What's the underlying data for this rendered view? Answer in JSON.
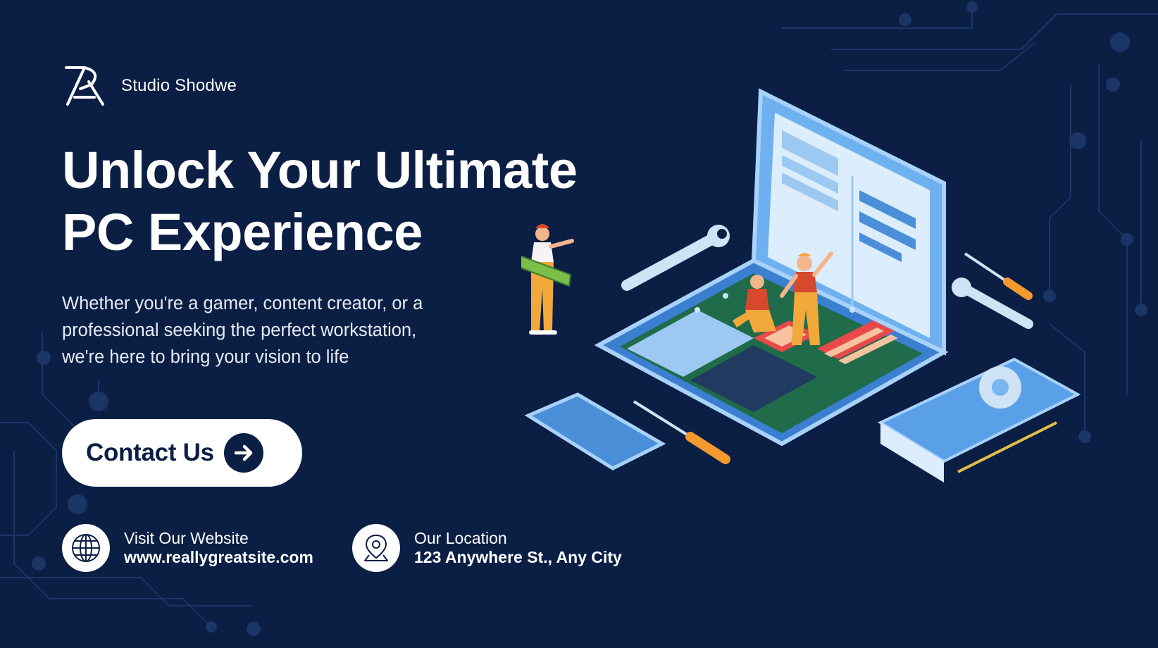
{
  "brand": {
    "name": "Studio Shodwe",
    "logo_icon": "monogram-logo-icon"
  },
  "headline": {
    "line1": "Unlock Your Ultimate",
    "line2": "PC Experience"
  },
  "subtext": {
    "line1": "Whether you're a gamer, content creator, or a",
    "line2": "professional seeking the perfect workstation,",
    "line3": "we're here to bring your vision to life"
  },
  "cta": {
    "label": "Contact Us",
    "icon": "arrow-right-icon"
  },
  "website": {
    "label": "Visit Our Website",
    "value": "www.reallygreatsite.com",
    "icon": "globe-icon"
  },
  "location": {
    "label": "Our Location",
    "value": "123 Anywhere St., Any City",
    "icon": "location-pin-icon"
  },
  "colors": {
    "background": "#0b1f45",
    "accent_blue": "#5aa0e8",
    "text": "#ffffff",
    "tool_orange": "#f29a2e"
  }
}
